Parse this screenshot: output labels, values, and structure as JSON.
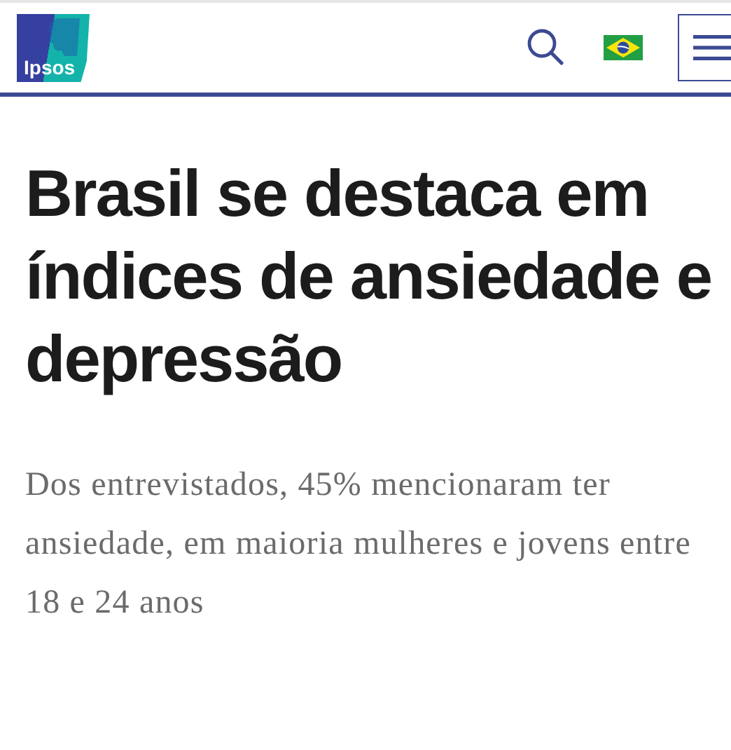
{
  "header": {
    "logo": "Ipsos"
  },
  "article": {
    "title": "Brasil se destaca em índices de ansiedade e depressão",
    "subtitle": "Dos entrevistados, 45% mencionaram ter ansiedade, em maioria mulheres e jovens entre 18 e 24 anos"
  }
}
